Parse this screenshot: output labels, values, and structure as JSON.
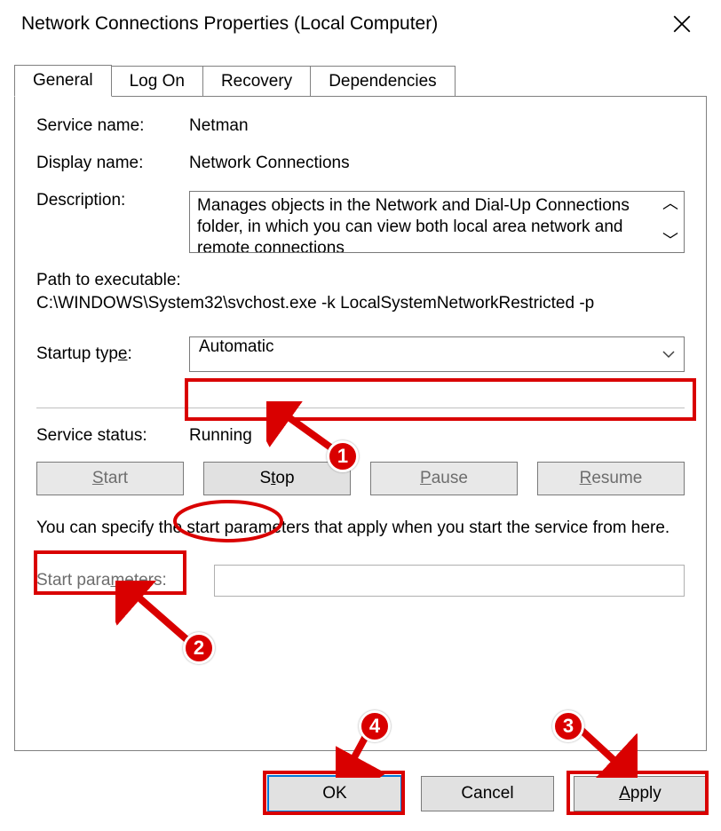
{
  "window": {
    "title": "Network Connections Properties (Local Computer)"
  },
  "tabs": {
    "general": "General",
    "logon": "Log On",
    "recovery": "Recovery",
    "dependencies": "Dependencies"
  },
  "labels": {
    "service_name": "Service name:",
    "display_name": "Display name:",
    "description": "Description:",
    "path_to_exec": "Path to executable:",
    "startup_type": "Startup type:",
    "service_status": "Service status:",
    "start_parameters": "Start parameters:"
  },
  "values": {
    "service_name": "Netman",
    "display_name": "Network Connections",
    "description": "Manages objects in the Network and Dial-Up Connections folder, in which you can view both local area network and remote connections",
    "path": "C:\\WINDOWS\\System32\\svchost.exe -k LocalSystemNetworkRestricted -p",
    "startup_type": "Automatic",
    "service_status": "Running"
  },
  "buttons": {
    "start": "Start",
    "stop": "Stop",
    "pause": "Pause",
    "resume": "Resume",
    "ok": "OK",
    "cancel": "Cancel",
    "apply": "Apply"
  },
  "text": {
    "specify": "You can specify the start parameters that apply when you start the service from here."
  },
  "annotations": {
    "b1": "1",
    "b2": "2",
    "b3": "3",
    "b4": "4"
  }
}
